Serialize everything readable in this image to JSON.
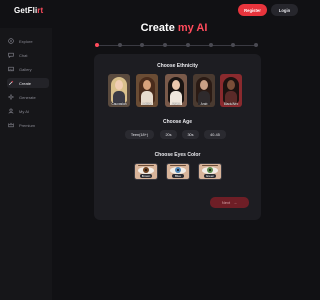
{
  "header": {
    "logo_main": "GetFli",
    "logo_accent": "rt",
    "register_label": "Register",
    "login_label": "Login"
  },
  "sidebar": {
    "items": [
      {
        "label": "Explore",
        "icon": "compass-icon",
        "active": false
      },
      {
        "label": "Chat",
        "icon": "chat-icon",
        "active": false
      },
      {
        "label": "Gallery",
        "icon": "gallery-icon",
        "active": false
      },
      {
        "label": "Create",
        "icon": "wand-icon",
        "active": true
      },
      {
        "label": "Generate",
        "icon": "sparkle-icon",
        "active": false
      },
      {
        "label": "My AI",
        "icon": "user-icon",
        "active": false
      },
      {
        "label": "Premium",
        "icon": "crown-icon",
        "active": false
      }
    ]
  },
  "page": {
    "title_main": "Create ",
    "title_accent": "my AI"
  },
  "stepper": {
    "total_steps": 8,
    "current_step": 1
  },
  "form": {
    "ethnicity_title": "Choose Ethnicity",
    "ethnicities": [
      "Caucasian",
      "Latina",
      "Asian",
      "Arab",
      "Black/Afro"
    ],
    "age_title": "Choose Age",
    "ages": [
      "Teen(18+)",
      "20s",
      "30s",
      "40-45"
    ],
    "eyes_title": "Choose Eyes Color",
    "eye_colors": [
      "Brown",
      "Blue",
      "Green"
    ],
    "next_label": "Next"
  },
  "colors": {
    "accent": "#ff4b5c",
    "background": "#111114",
    "card": "#1d1d22"
  }
}
